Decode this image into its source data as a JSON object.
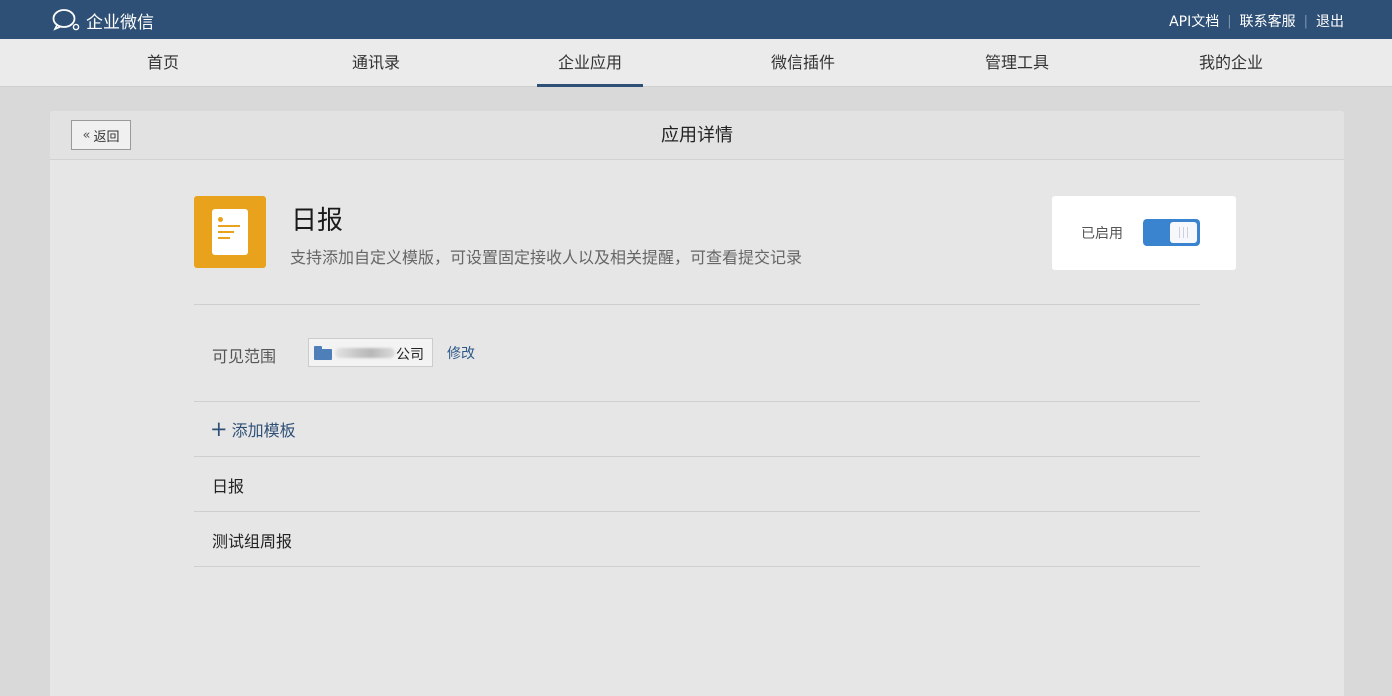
{
  "topbar": {
    "logo_text": "企业微信",
    "links": [
      "API文档",
      "联系客服",
      "退出"
    ]
  },
  "nav": {
    "items": [
      "首页",
      "通讯录",
      "企业应用",
      "微信插件",
      "管理工具",
      "我的企业"
    ],
    "active_index": 2
  },
  "panel": {
    "back_label": "返回",
    "title": "应用详情"
  },
  "app": {
    "name": "日报",
    "description": "支持添加自定义模版，可设置固定接收人以及相关提醒，可查看提交记录",
    "status_label": "已启用",
    "enabled": true
  },
  "scope": {
    "label": "可见范围",
    "value_suffix": "公司",
    "modify_label": "修改"
  },
  "templates": {
    "add_label": "添加模板",
    "items": [
      "日报",
      "测试组周报"
    ]
  },
  "colors": {
    "topbar": "#2e5076",
    "accent": "#3a84cf",
    "app_icon": "#e8a21b"
  },
  "icons": {
    "logo": "chat-bubble-icon",
    "back": "double-chevron-left-icon",
    "app": "document-icon",
    "scope": "folder-icon",
    "add": "plus-icon"
  }
}
